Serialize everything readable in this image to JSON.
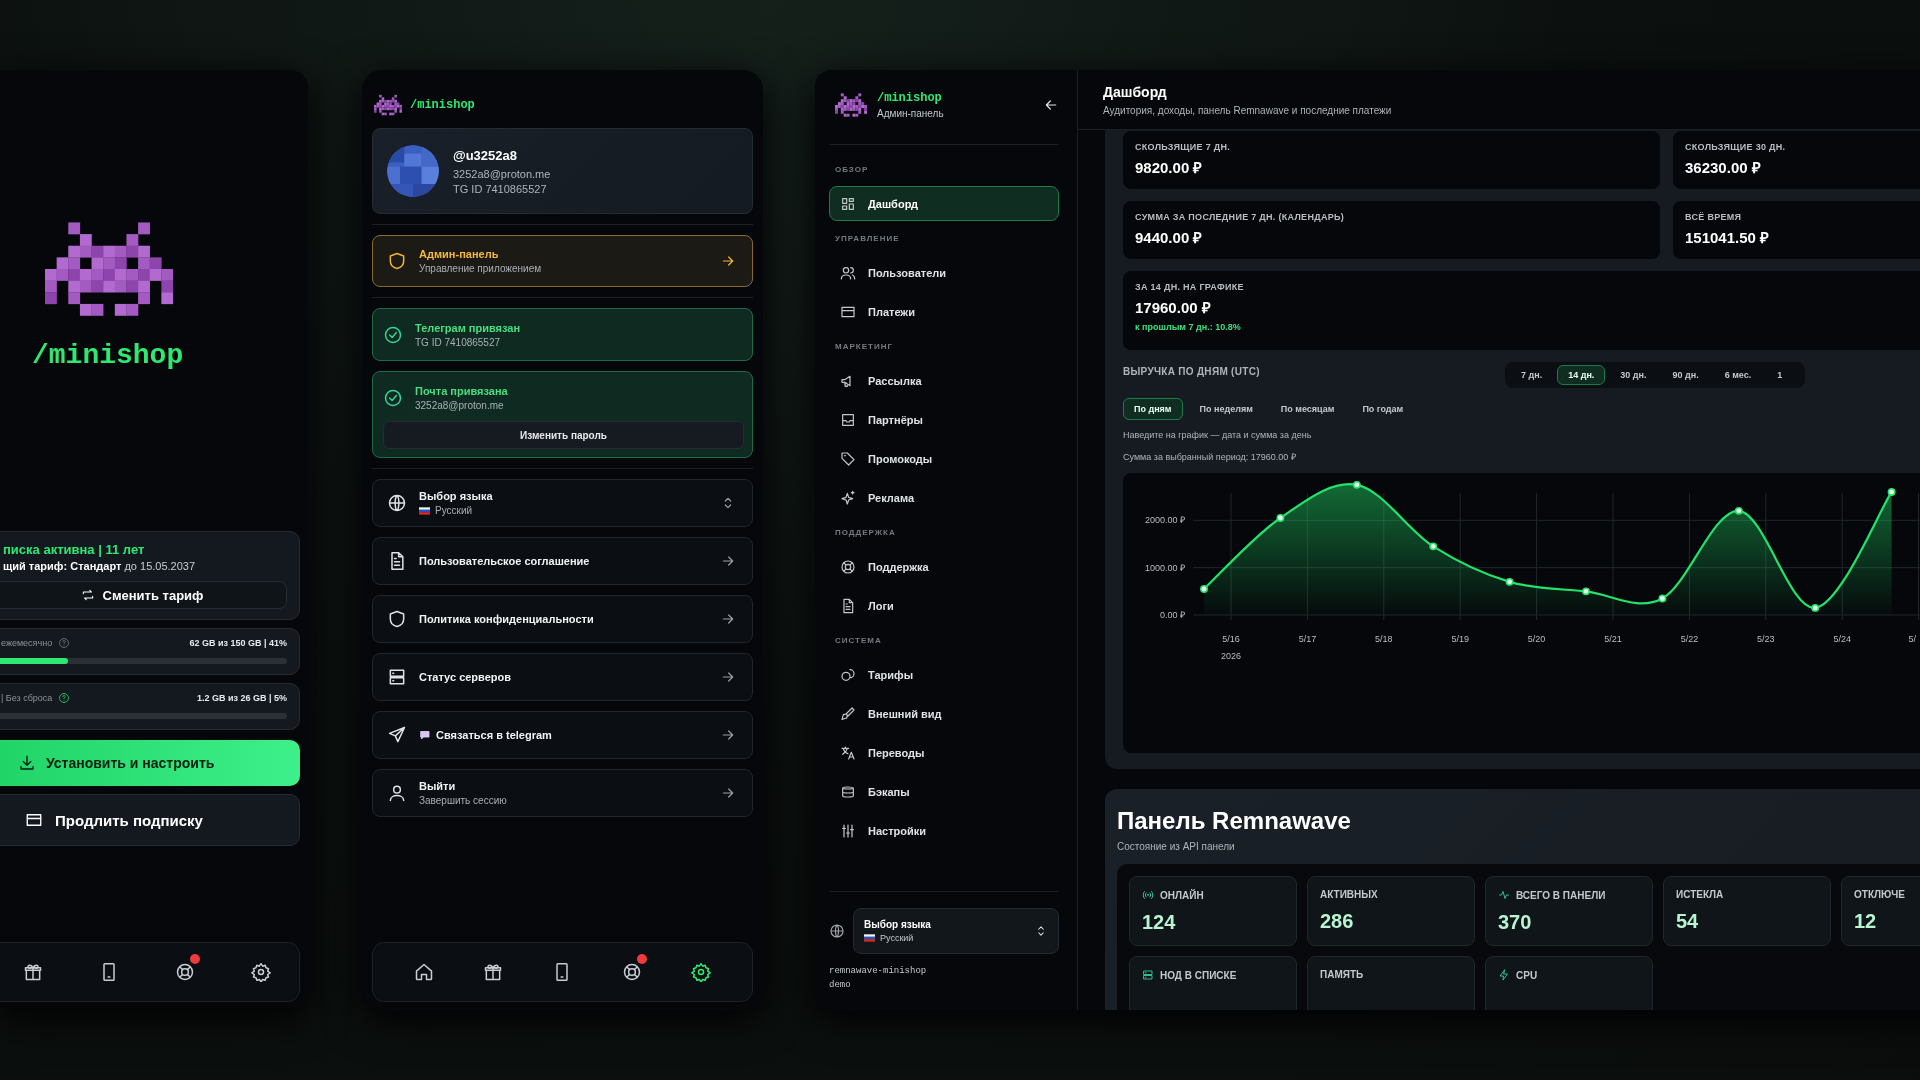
{
  "left_panel": {
    "brand": "/minishop",
    "subscription": {
      "status": "писка активна | 11 лет",
      "tariff": "**щий тариф: Стандарт** до 15.05.2037",
      "change_button": "Сменить тариф"
    },
    "traffic": [
      {
        "label": "ежемесячно",
        "help_highlighted": false,
        "reading": "62 GB из 150 GB | 41%",
        "level": 0.27
      },
      {
        "label": "| Без сброса",
        "help_highlighted": true,
        "reading": "1.2 GB из 26 GB | 5%"
      }
    ],
    "install_button": "Установить и настроить",
    "renew_button": "Продлить подписку",
    "nav": [
      {
        "selected": false,
        "dot": false
      },
      {
        "selected": false,
        "dot": false
      },
      {
        "selected": false,
        "dot": true
      },
      {
        "selected": false,
        "dot": false
      }
    ]
  },
  "middle_panel": {
    "brand": "/minishop",
    "profile": {
      "username": "@u3252a8",
      "email": "3252a8@proton.me",
      "tg_id": "TG ID 7410865527"
    },
    "admin": {
      "title": "Админ-панель",
      "subtitle": "Управление приложением"
    },
    "linked": [
      {
        "title": "Телеграм привязан",
        "subtitle": "TG ID 7410865527"
      },
      {
        "title": "Почта привязана",
        "subtitle": "3252a8@proton.me",
        "button": "Изменить пароль"
      }
    ],
    "menu": [
      {
        "kind": "select",
        "title": "Выбор языка",
        "subtitle": "Русский"
      },
      {
        "kind": "link",
        "title": "Пользовательское соглашение"
      },
      {
        "kind": "link",
        "title": "Политика конфиденциальности"
      },
      {
        "kind": "link",
        "title": "Статус серверов"
      },
      {
        "kind": "link",
        "title": "Связаться в telegram"
      },
      {
        "kind": "link",
        "title": "Выйти",
        "subtitle": "Завершить сессию"
      }
    ],
    "nav": [
      {
        "selected": false,
        "dot": false
      },
      {
        "selected": false,
        "dot": false
      },
      {
        "selected": false,
        "dot": false
      },
      {
        "selected": false,
        "dot": true
      },
      {
        "selected": true,
        "dot": false
      }
    ]
  },
  "admin": {
    "sidebar": {
      "brand": "/minishop",
      "subtitle": "Админ-панель",
      "sections": [
        {
          "title": "ОБЗОР",
          "items": [
            {
              "label": "Дашборд",
              "selected": true
            }
          ]
        },
        {
          "title": "УПРАВЛЕНИЕ",
          "items": [
            {
              "label": "Пользователи",
              "selected": false
            },
            {
              "label": "Платежи",
              "selected": false
            }
          ]
        },
        {
          "title": "МАРКЕТИНГ",
          "items": [
            {
              "label": "Рассылка",
              "selected": false
            },
            {
              "label": "Партнёры",
              "selected": false
            },
            {
              "label": "Промокоды",
              "selected": false
            },
            {
              "label": "Реклама",
              "selected": false
            }
          ]
        },
        {
          "title": "ПОДДЕРЖКА",
          "items": [
            {
              "label": "Поддержка",
              "selected": false
            },
            {
              "label": "Логи",
              "selected": false
            }
          ]
        },
        {
          "title": "СИСТЕМА",
          "items": [
            {
              "label": "Тарифы",
              "selected": false
            },
            {
              "label": "Внешний вид",
              "selected": false
            },
            {
              "label": "Переводы",
              "selected": false
            },
            {
              "label": "Бэкапы",
              "selected": false
            },
            {
              "label": "Настройки",
              "selected": false
            }
          ]
        }
      ],
      "language": {
        "title": "Выбор языка",
        "value": "Русский"
      },
      "footer": [
        "remnawave-minishop",
        "demo"
      ]
    },
    "header": {
      "title": "Дашборд",
      "subtitle": "Аудитория, доходы, панель Remnawave и последние платежи"
    },
    "stats": [
      {
        "label": "СКОЛЬЗЯЩИЕ 7 ДН.",
        "value": "9820.00 ₽"
      },
      {
        "label": "СКОЛЬЗЯЩИЕ 30 ДН.",
        "value": "36230.00 ₽"
      },
      {
        "label": "СУММА ЗА ПОСЛЕДНИЕ 7 ДН. (КАЛЕНДАРЬ)",
        "value": "9440.00 ₽"
      },
      {
        "label": "ВСЁ ВРЕМЯ",
        "value": "151041.50 ₽"
      },
      {
        "label": "ЗА 14 ДН. НА ГРАФИКЕ",
        "value": "17960.00 ₽",
        "delta": "к прошлым 7 дн.: 10.8%"
      }
    ],
    "revenue": {
      "title": "ВЫРУЧКА ПО ДНЯМ (UTC)",
      "periods": [
        {
          "label": "7 дн.",
          "selected": false
        },
        {
          "label": "14 дн.",
          "selected": true
        },
        {
          "label": "30 дн.",
          "selected": false
        },
        {
          "label": "90 дн.",
          "selected": false
        },
        {
          "label": "6 мес.",
          "selected": false
        },
        {
          "label": "1",
          "selected": false
        }
      ],
      "modes": [
        {
          "label": "По дням",
          "selected": true
        },
        {
          "label": "По неделям",
          "selected": false
        },
        {
          "label": "По месяцам",
          "selected": false
        },
        {
          "label": "По годам",
          "selected": false
        }
      ],
      "hint": "Наведите на график — дата и сумма за день",
      "total": "Сумма за выбранный период: 17960.00 ₽",
      "year_label": "2026",
      "chart_data": {
        "type": "area",
        "categories": [
          "5/16",
          "5/17",
          "5/18",
          "5/19",
          "5/20",
          "5/21",
          "5/22",
          "5/23",
          "5/24",
          "5/"
        ],
        "series": [
          {
            "color": "#22e36b",
            "values": [
              550,
              2050,
              2750,
              1450,
              700,
              500,
              350,
              2200,
              150,
              2600
            ]
          }
        ],
        "ylim": [
          0,
          3000
        ],
        "grid": true,
        "yticks": [
          {
            "value": 0,
            "label": "0.00 ₽"
          },
          {
            "value": 1000,
            "label": "1000.00 ₽"
          },
          {
            "value": 2000,
            "label": "2000.00 ₽"
          }
        ]
      }
    },
    "remnawave": {
      "title": "Панель Remnawave",
      "subtitle": "Состояние из API панели",
      "tiles": [
        {
          "label": "ОНЛАЙН",
          "value": "124"
        },
        {
          "label": "АКТИВНЫХ",
          "value": "286"
        },
        {
          "label": "ВСЕГО В ПАНЕЛИ",
          "value": "370"
        },
        {
          "label": "ИСТЕКЛА",
          "value": "54"
        },
        {
          "label": "ОТКЛЮЧЕ",
          "value": "12"
        },
        {
          "label": "НОД В СПИСКЕ"
        },
        {
          "label": "ПАМЯТЬ"
        },
        {
          "label": "CPU"
        }
      ]
    }
  }
}
